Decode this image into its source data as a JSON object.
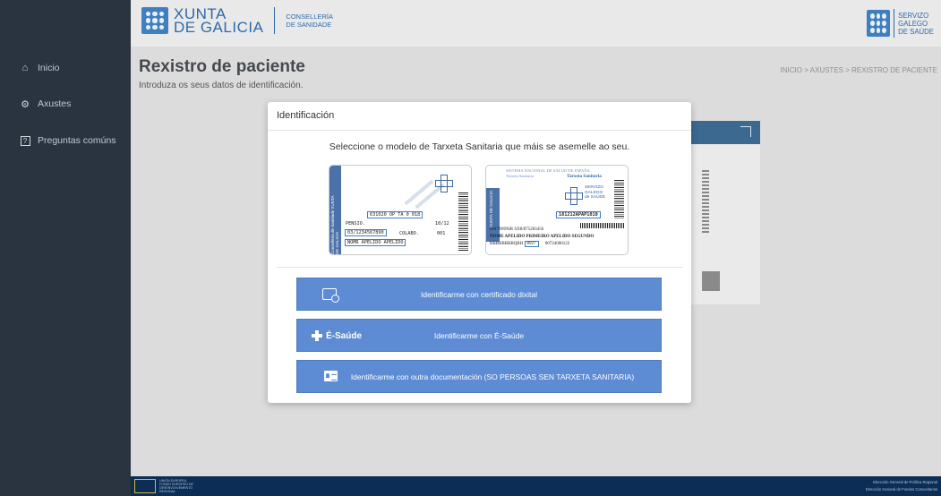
{
  "header": {
    "xunta_line1": "XUNTA",
    "xunta_line2": "DE GALICIA",
    "conselleria_line1": "CONSELLERÍA",
    "conselleria_line2": "DE SANIDADE",
    "sergas_line1": "SERVIZO",
    "sergas_line2": "GALEGO",
    "sergas_line3": "DE SAÚDE",
    "logo_icon": "galicia-crest-icon"
  },
  "sidebar": {
    "items": [
      {
        "label": "Inicio",
        "icon": "home-icon"
      },
      {
        "label": "Axustes",
        "icon": "gear-icon"
      },
      {
        "label": "Preguntas comúns",
        "icon": "question-icon"
      }
    ]
  },
  "main": {
    "title": "Rexistro de paciente",
    "subtitle": "Introduza os seus datos de identificación.",
    "breadcrumb": {
      "items": [
        "INICIO",
        "AXUSTES",
        "REXISTRO DE PACIENTE"
      ],
      "separator": ">"
    }
  },
  "modal": {
    "title": "Identificación",
    "instruction": "Seleccione o modelo de Tarxeta Sanitaria que máis se asemelle ao seu.",
    "card_old": {
      "stripe_text": "Consellería de Sanidade XUNTA DE GALICIA",
      "line_code": "631020  OP  TA  0  018",
      "line_pensio": "PENSIO.",
      "line_date": "10/12",
      "line_id": "03/1234567890",
      "line_colabo": "COLABO.",
      "line_colabo_num": "001",
      "line_name": "NOMR  APELIDO  APELIDO"
    },
    "card_new": {
      "header1": "SISTEMA NACIONAL DE SALUD DE ESPAÑA",
      "header2": "Tarxeta Sanitaria",
      "header3": "Tarxeta Sanitaria",
      "stripe_text": "XUNTA DE GALICIA",
      "sergas_line1": "SERVIZO",
      "sergas_line2": "GALEGO",
      "sergas_line3": "de SAÚDE",
      "code": "181212APAP1010",
      "line_ids": "00479699SR        SX8/875283456",
      "line_name": "NOME APELIDO PRIMEIRO APELIDO SEGUNDO",
      "line_bottom_a": "BBBBBBBBQRH",
      "line_bottom_b": "8927",
      "line_bottom_c": "00724000122"
    },
    "buttons": {
      "cert_label": "Identificarme con certificado dixital",
      "cert_icon": "certificate-icon",
      "esaude_brand": "É-Saúde",
      "esaude_label": "Identificarme con É-Saúde",
      "esaude_icon": "esaude-cross-icon",
      "other_label": "Identificarme con outra documentación (SO PERSOAS SEN TARXETA SANITARIA)",
      "other_icon": "id-card-icon"
    }
  },
  "footer": {
    "eu_text_1": "UNIÓN EUROPEA",
    "eu_text_2": "FONDO EUROPEO DE",
    "eu_text_3": "DESENVOLVEMENTO",
    "eu_text_4": "REXIONAL",
    "right_line1": "Dirección General de Política Regional",
    "right_line2": "Dirección General de Fondos Comunitarios"
  },
  "colors": {
    "sidebar": "#2a3441",
    "accent_button": "#5d8cd4",
    "brand_blue": "#2d6aa8",
    "footer": "#0c2d56"
  }
}
